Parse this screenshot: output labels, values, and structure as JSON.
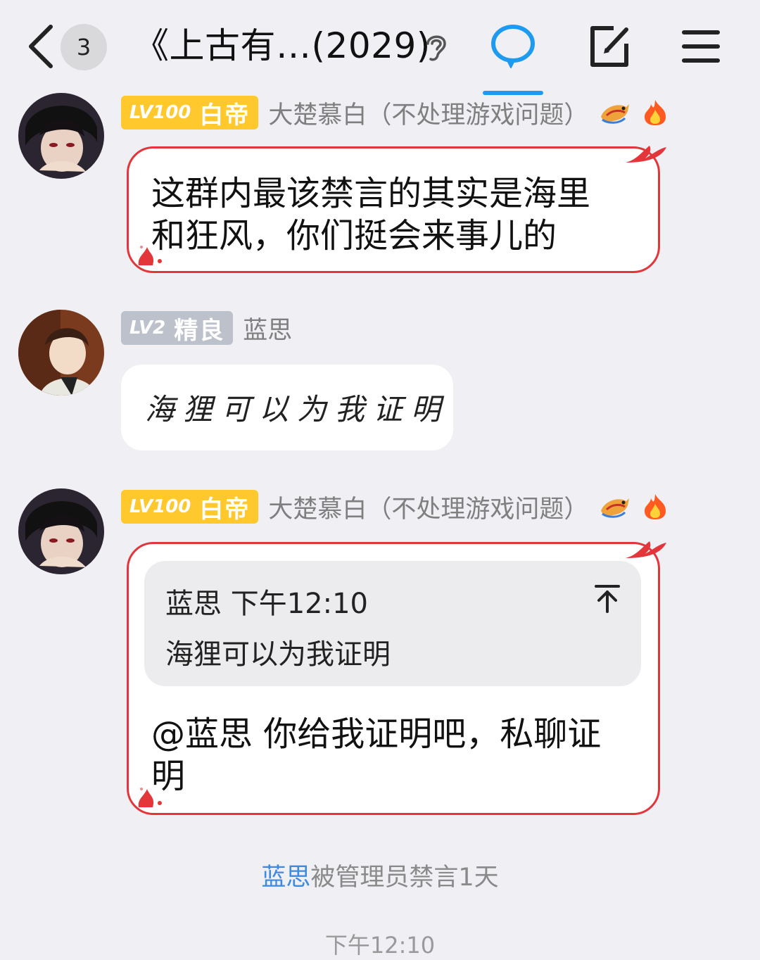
{
  "header": {
    "unread_count": "3",
    "title": "《上古有…(2029)",
    "icons": [
      "back-chevron-icon",
      "ear-icon",
      "chat-bubble-icon",
      "edit-icon",
      "menu-icon"
    ]
  },
  "messages": [
    {
      "level": "LV100",
      "rank": "白帝",
      "sender": "大楚慕白（不处理游戏问题）",
      "text_line1": "这群内最该禁言的其实是海里",
      "text_line2": "和狂风，你们挺会来事儿的"
    },
    {
      "level": "LV2",
      "rank": "精良",
      "sender": "蓝思",
      "text": "海狸可以为我证明"
    },
    {
      "level": "LV100",
      "rank": "白帝",
      "sender": "大楚慕白（不处理游戏问题）",
      "quote": {
        "author_time": "蓝思  下午12:10",
        "text": "海狸可以为我证明"
      },
      "text_line1": "@蓝思 你给我证明吧，私聊证",
      "text_line2": "明"
    }
  ],
  "system": {
    "name": "蓝思",
    "action": "被管理员禁言1天"
  },
  "timestamp": "下午12:10",
  "colors": {
    "accent": "#1e9bf0",
    "bubble_border": "#e2363b",
    "level_gold": "#ffc92e",
    "level_gray": "#bcc1cc",
    "system_name": "#3d8ae0"
  }
}
